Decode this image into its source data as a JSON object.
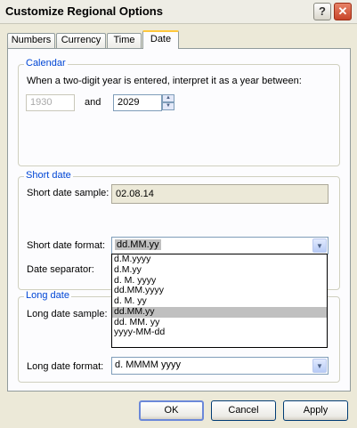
{
  "window": {
    "title": "Customize Regional Options",
    "help_glyph": "?",
    "close_glyph": "✕"
  },
  "tabs": [
    {
      "label": "Numbers"
    },
    {
      "label": "Currency"
    },
    {
      "label": "Time"
    },
    {
      "label": "Date",
      "active": true
    }
  ],
  "calendar": {
    "group_label": "Calendar",
    "description": "When a two-digit year is entered, interpret it as a year between:",
    "year_from": "1930",
    "and_label": "and",
    "year_to": "2029"
  },
  "short_date": {
    "group_label": "Short date",
    "sample_label": "Short date sample:",
    "sample_value": "02.08.14",
    "format_label": "Short date format:",
    "format_value": "dd.MM.yy",
    "separator_label": "Date separator:",
    "dropdown_options": [
      "d.M.yyyy",
      "d.M.yy",
      "d. M. yyyy",
      "dd.MM.yyyy",
      "d. M. yy",
      "dd.MM.yy",
      "dd. MM. yy",
      "yyyy-MM-dd"
    ],
    "dropdown_selected": "dd.MM.yy"
  },
  "long_date": {
    "group_label": "Long date",
    "sample_label": "Long date sample:",
    "format_label": "Long date format:",
    "format_value": "d. MMMM yyyy"
  },
  "buttons": {
    "ok": "OK",
    "cancel": "Cancel",
    "apply": "Apply"
  },
  "icons": {
    "spinner_up": "▲",
    "spinner_down": "▼",
    "combo_arrow": "▼"
  }
}
